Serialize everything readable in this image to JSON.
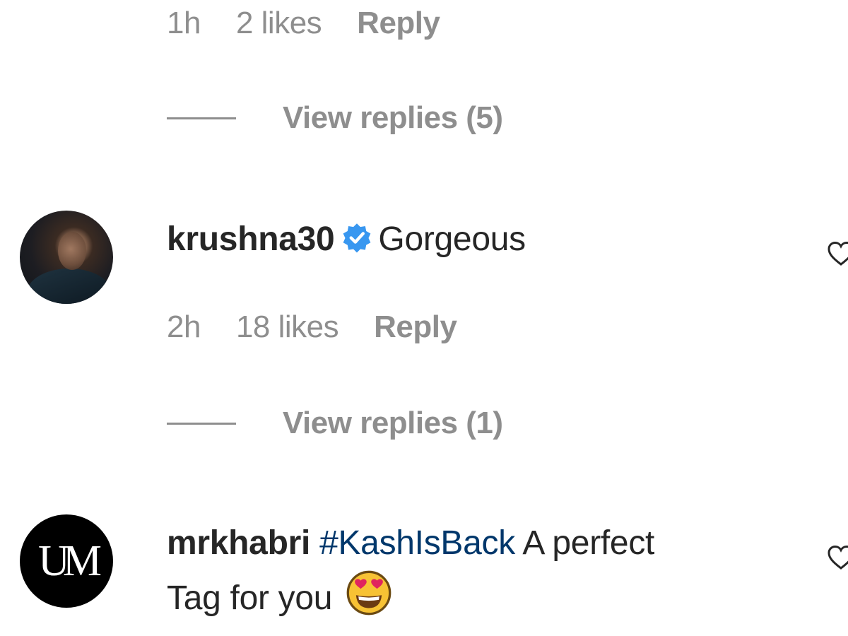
{
  "comments": [
    {
      "meta": {
        "time": "1h",
        "likes": "2 likes",
        "reply_label": "Reply"
      },
      "view_replies": "View replies (5)"
    },
    {
      "username": "krushna30",
      "verified": true,
      "text": "Gorgeous",
      "meta": {
        "time": "2h",
        "likes": "18 likes",
        "reply_label": "Reply"
      },
      "view_replies": "View replies (1)",
      "avatar_icon": "profile-photo-icon"
    },
    {
      "username": "mrkhabri",
      "hashtag": "#KashIsBack",
      "text_after_hashtag": "A perfect",
      "text_line2": "Tag for you",
      "emoji": "heart-eyes-emoji",
      "avatar_logo_text": "UM"
    }
  ],
  "colors": {
    "meta_gray": "#8e8e8e",
    "text_dark": "#262626",
    "hashtag_blue": "#00376b",
    "verified_blue": "#3897f0"
  }
}
